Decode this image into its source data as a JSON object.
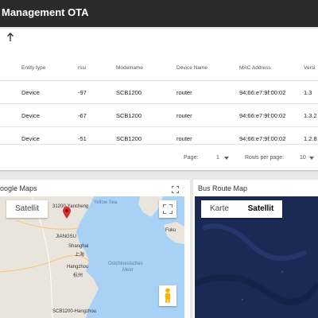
{
  "app": {
    "title": "Management OTA"
  },
  "table": {
    "headers": {
      "entity_type": "Entity type",
      "rssi": "rssi",
      "modelname": "Modelname",
      "device_name": "Device Name",
      "mac": "MAC Address",
      "version": "Versi"
    },
    "rows": [
      {
        "entity_type": "Device",
        "rssi": "-97",
        "modelname": "SCB1200",
        "device_name": "router",
        "mac": "94:66:e7:9f:00:02",
        "version": "1.3"
      },
      {
        "entity_type": "Device",
        "rssi": "-67",
        "modelname": "SCB1200",
        "device_name": "router",
        "mac": "94:66:e7:9f:00:02",
        "version": "1.3.2"
      },
      {
        "entity_type": "Device",
        "rssi": "-51",
        "modelname": "SCB1200",
        "device_name": "router",
        "mac": "94:66:e7:9f:00:02",
        "version": "1.2.8"
      }
    ],
    "pagination": {
      "page_label": "Page:",
      "page_value": "1",
      "rows_label": "Rows per page:",
      "rows_value": "10"
    }
  },
  "google_maps": {
    "title": "oogle Maps",
    "satellite_label": "Satellit",
    "labels": {
      "marker": "31200-Yancheng",
      "yellow_sea": "Yellow Sea",
      "jiangsu": "JIANGSU",
      "shanghai": "Shanghai",
      "shanghai_cn": "上海",
      "hangzhou": "Hangzhou",
      "hangzhou_cn": "杭州",
      "ostchina": "Ostchinesisches",
      "meer": "Meer",
      "fukuoka": "Fuku",
      "bottom": "SCB1200-Hangzhou"
    },
    "colors": {
      "land": "#e9e5dc",
      "sea": "#a9d0f5",
      "marker": "#d32f2f"
    }
  },
  "bus_route_map": {
    "title": "Bus Route Map",
    "map_label": "Karte",
    "satellite_label": "Satellit",
    "colors": {
      "ocean": "#1b2a55"
    }
  }
}
